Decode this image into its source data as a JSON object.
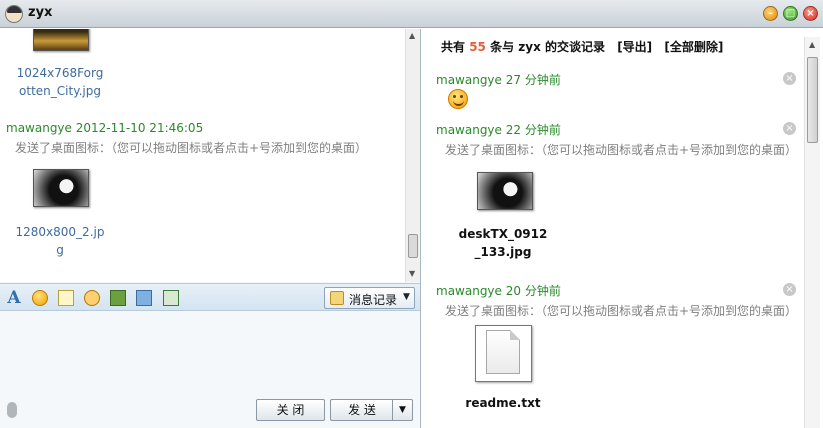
{
  "window": {
    "title": "zyx"
  },
  "left_chat": {
    "file1": {
      "name_lines": [
        "1024x768Forg",
        "otten_City.jpg"
      ]
    },
    "message": {
      "sender": "mawangye",
      "timestamp": "2012-11-10 21:46:05",
      "text": "发送了桌面图标：（您可以拖动图标或者点击+号添加到您的桌面）"
    },
    "file2": {
      "name_lines": [
        "1280x800_2.jp",
        "g"
      ]
    }
  },
  "toolbar": {
    "icons": [
      "font-icon",
      "emoticon-icon",
      "note-icon",
      "magic-face-icon",
      "picture-icon",
      "send-file-icon",
      "screenshot-icon"
    ],
    "history_label": "消息记录"
  },
  "input_area": {
    "close_label": "关 闭",
    "send_label": "发 送"
  },
  "history": {
    "summary": {
      "prefix": "共有",
      "count": "55",
      "suffix": "条与 zyx 的交谈记录",
      "export": "[导出]",
      "delete_all": "[全部删除]"
    },
    "entries": [
      {
        "sender": "mawangye",
        "time": "27 分钟前"
      },
      {
        "sender": "mawangye",
        "time": "22 分钟前",
        "text": "发送了桌面图标：（您可以拖动图标或者点击+号添加到您的桌面）",
        "file_lines": [
          "deskTX_0912",
          "_133.jpg"
        ]
      },
      {
        "sender": "mawangye",
        "time": "20 分钟前",
        "text": "发送了桌面图标：（您可以拖动图标或者点击+号添加到您的桌面）",
        "file_lines": [
          "readme.txt"
        ]
      }
    ]
  },
  "colors": {
    "sender": "#2a8a2a",
    "link": "#3e6b9c",
    "count": "#e0603a",
    "system": "#7f7f7f"
  }
}
